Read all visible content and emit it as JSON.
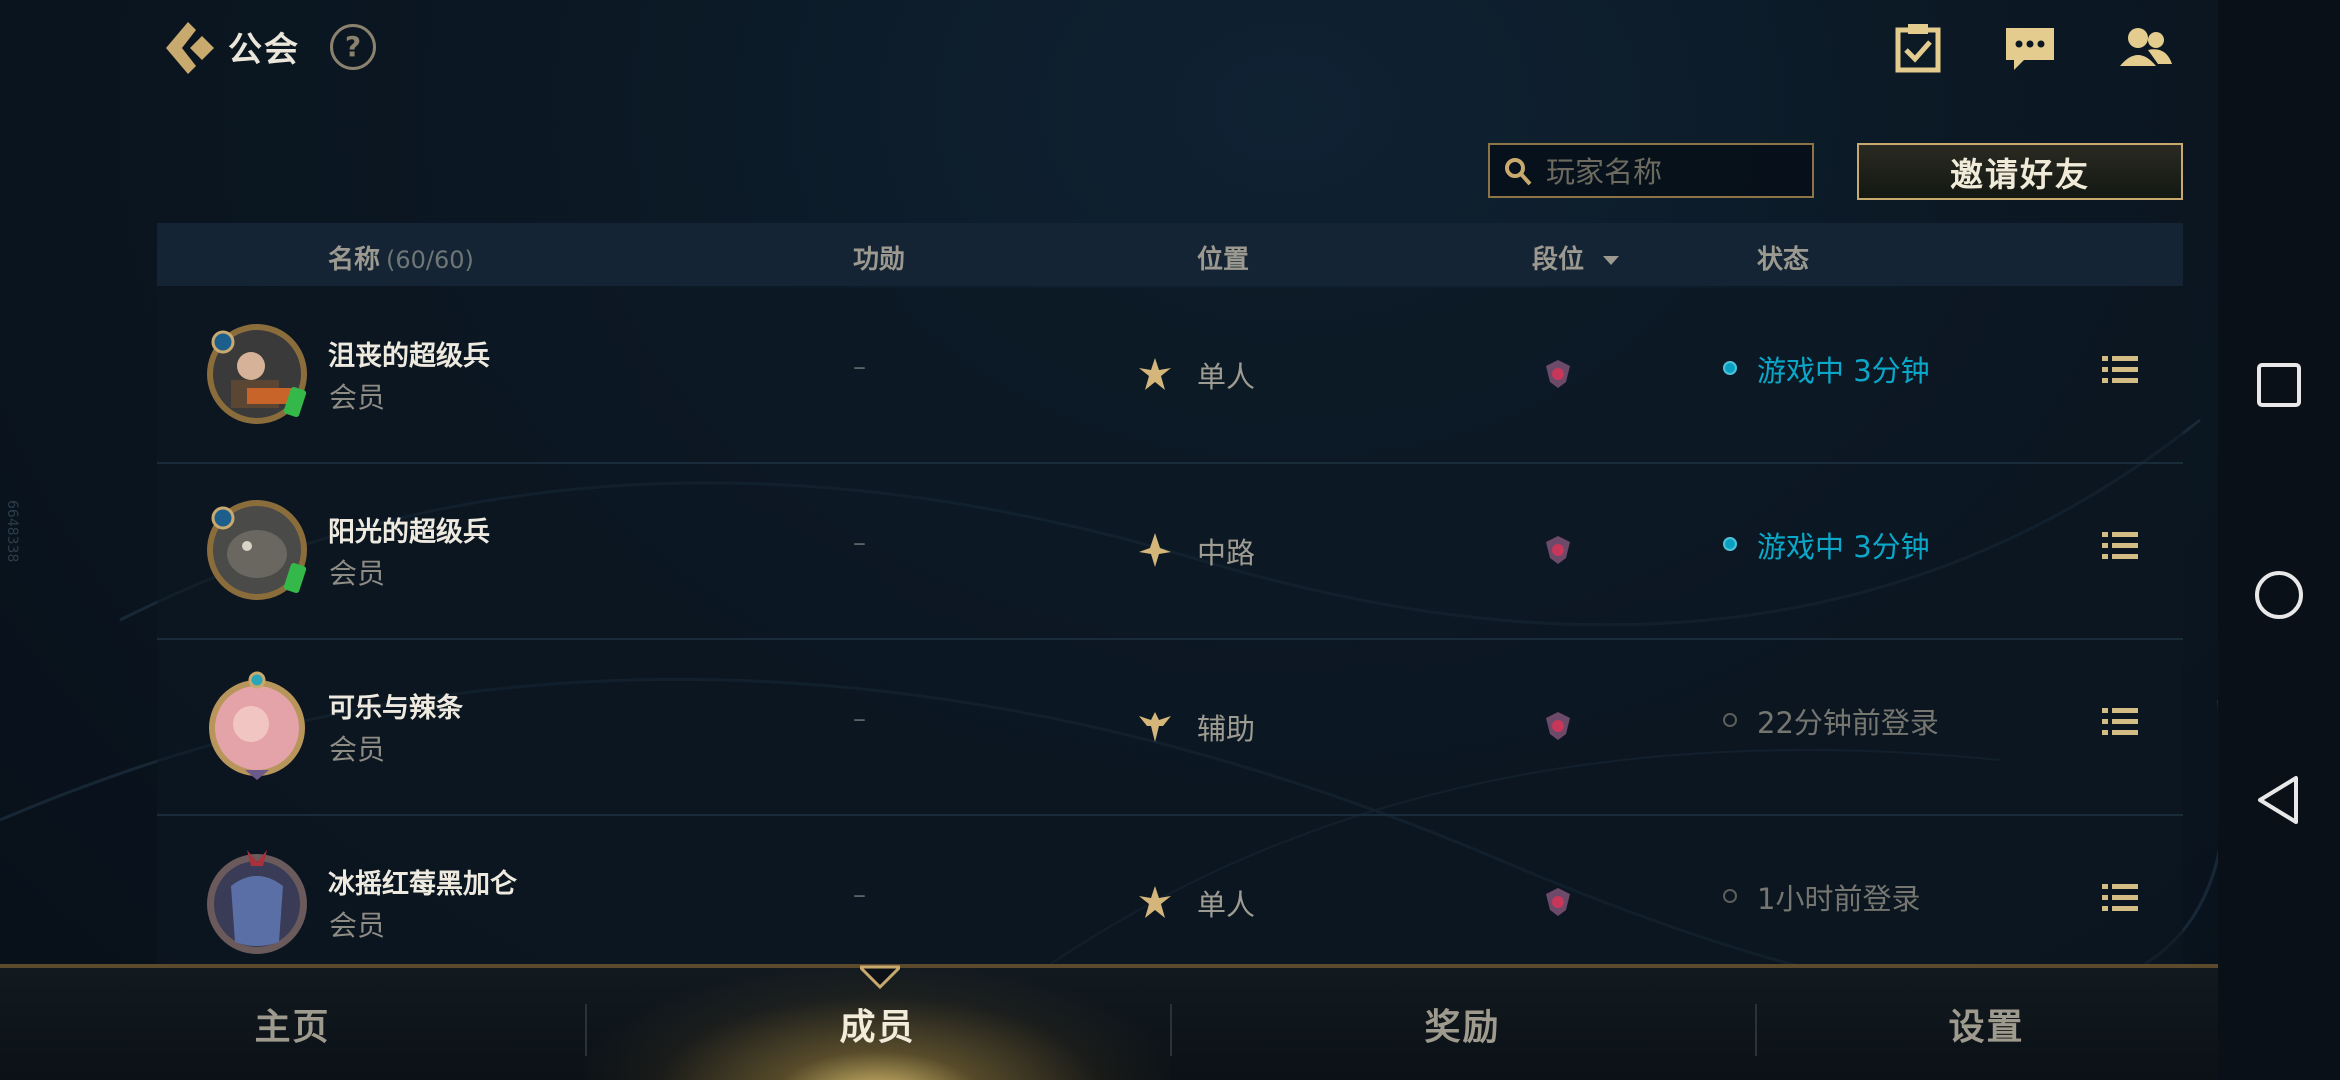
{
  "header": {
    "title": "公会",
    "help_glyph": "?",
    "icons": [
      "back-icon",
      "help-icon",
      "task-check-icon",
      "chat-icon",
      "friends-icon"
    ]
  },
  "search": {
    "placeholder": "玩家名称",
    "value": ""
  },
  "invite_button": "邀请好友",
  "table": {
    "headers": {
      "name": "名称",
      "name_count": "(60/60)",
      "merit": "功勋",
      "position": "位置",
      "rank": "段位",
      "status": "状态"
    },
    "rows": [
      {
        "name": "沮丧的超级兵",
        "role": "会员",
        "merit": "–",
        "position": "单人",
        "position_icon": "solo-lane-icon",
        "status": "游戏中 3分钟",
        "online": true
      },
      {
        "name": "阳光的超级兵",
        "role": "会员",
        "merit": "–",
        "position": "中路",
        "position_icon": "mid-lane-icon",
        "status": "游戏中 3分钟",
        "online": true
      },
      {
        "name": "可乐与辣条",
        "role": "会员",
        "merit": "–",
        "position": "辅助",
        "position_icon": "support-icon",
        "status": "22分钟前登录",
        "online": false
      },
      {
        "name": "冰摇红莓黑加仑",
        "role": "会员",
        "merit": "–",
        "position": "单人",
        "position_icon": "solo-lane-icon",
        "status": "1小时前登录",
        "online": false
      }
    ]
  },
  "tabs": [
    {
      "label": "主页",
      "active": false
    },
    {
      "label": "成员",
      "active": true
    },
    {
      "label": "奖励",
      "active": false
    },
    {
      "label": "设置",
      "active": false
    }
  ],
  "system_nav": [
    "recent-apps-icon",
    "home-icon",
    "back-nav-icon"
  ],
  "side_id": "6648338",
  "colors": {
    "accent_gold": "#c8aa6e",
    "online_blue": "#0ba7c8",
    "background": "#0b1722"
  }
}
